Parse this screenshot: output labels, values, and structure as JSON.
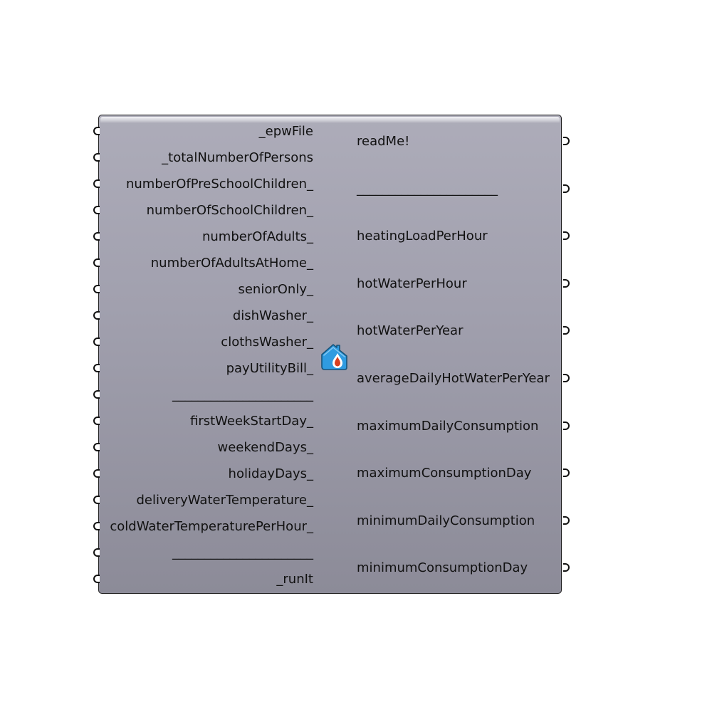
{
  "component": {
    "icon": "house-water-drop-icon",
    "colors": {
      "body_top": "#adacb9",
      "body_bottom": "#8c8b98",
      "border": "#202020",
      "grip": "#111111",
      "icon_house": "#2f9be0",
      "icon_drop": "#d9401f"
    },
    "inputs": [
      {
        "label": "_epwFile"
      },
      {
        "label": "_totalNumberOfPersons"
      },
      {
        "label": "numberOfPreSchoolChildren_"
      },
      {
        "label": "numberOfSchoolChildren_"
      },
      {
        "label": "numberOfAdults_"
      },
      {
        "label": "numberOfAdultsAtHome_"
      },
      {
        "label": "seniorOnly_"
      },
      {
        "label": "dishWasher_"
      },
      {
        "label": "clothsWasher_"
      },
      {
        "label": "payUtilityBill_"
      },
      {
        "label": "______________________"
      },
      {
        "label": "firstWeekStartDay_"
      },
      {
        "label": "weekendDays_"
      },
      {
        "label": "holidayDays_"
      },
      {
        "label": "deliveryWaterTemperature_"
      },
      {
        "label": "coldWaterTemperaturePerHour_"
      },
      {
        "label": "______________________"
      },
      {
        "label": "_runIt"
      }
    ],
    "outputs": [
      {
        "label": "readMe!"
      },
      {
        "label": "______________________"
      },
      {
        "label": "heatingLoadPerHour"
      },
      {
        "label": "hotWaterPerHour"
      },
      {
        "label": "hotWaterPerYear"
      },
      {
        "label": "averageDailyHotWaterPerYear"
      },
      {
        "label": "maximumDailyConsumption"
      },
      {
        "label": "maximumConsumptionDay"
      },
      {
        "label": "minimumDailyConsumption"
      },
      {
        "label": "minimumConsumptionDay"
      }
    ]
  }
}
